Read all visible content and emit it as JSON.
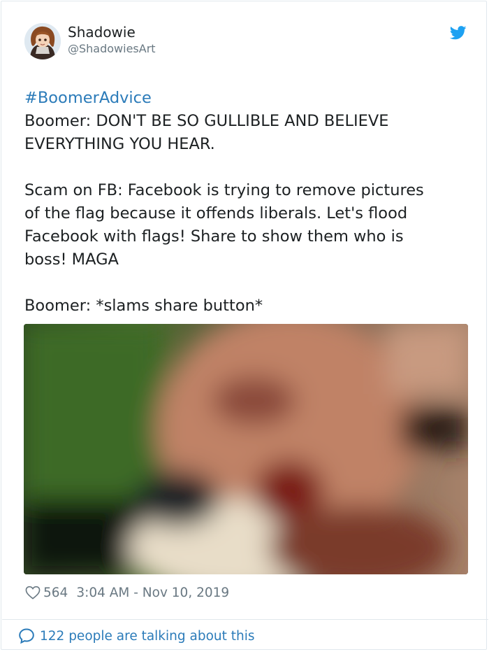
{
  "tweet": {
    "author": {
      "name": "Shadowie",
      "handle": "@ShadowiesArt"
    },
    "hashtag": "#BoomerAdvice",
    "lines": [
      "Boomer: DON'T BE SO GULLIBLE AND BELIEVE",
      "EVERYTHING YOU HEAR.",
      "",
      "Scam on FB: Facebook is trying to remove pictures",
      "of the flag because it offends liberals. Let's flood",
      "Facebook with flags! Share to show them who is",
      "boss! MAGA",
      "",
      "Boomer: *slams share button*"
    ],
    "likes": "564",
    "timestamp": "3:04 AM - Nov 10, 2019",
    "conversation": "122 people are talking about this"
  },
  "icons": {
    "brand": "twitter-bird-icon",
    "like": "heart-icon",
    "reply": "speech-bubble-icon"
  },
  "colors": {
    "brand_blue": "#1da1f2",
    "link_blue": "#2b7bb9",
    "meta_gray": "#697882",
    "text": "#1c2022"
  }
}
